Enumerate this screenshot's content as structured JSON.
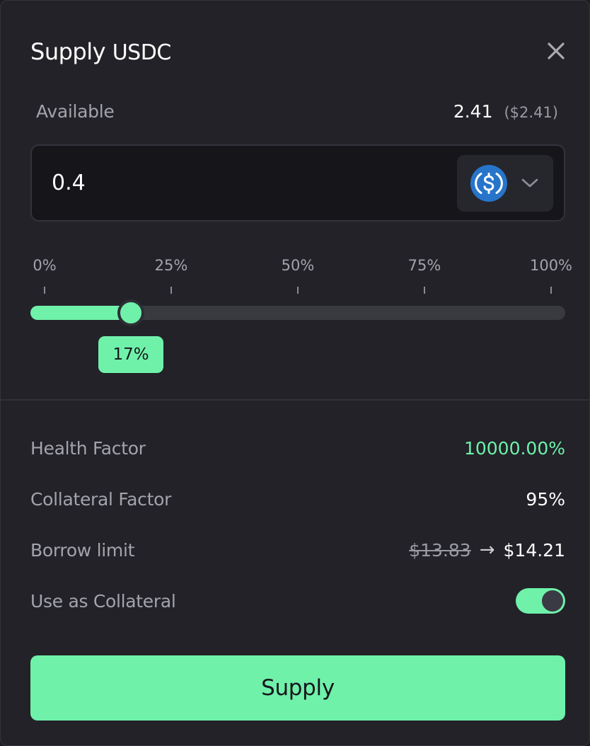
{
  "header": {
    "title": "Supply",
    "symbol": "USDC"
  },
  "available": {
    "label": "Available",
    "amount": "2.41",
    "usd": "($2.41)"
  },
  "amount_input": {
    "value": "0.4",
    "token_icon": "usdc-icon",
    "dropdown_icon": "chevron-down-icon"
  },
  "slider": {
    "ticks": [
      "0%",
      "25%",
      "50%",
      "75%",
      "100%"
    ],
    "value_percent": 17,
    "value_label": "17%"
  },
  "stats": {
    "health_factor": {
      "label": "Health Factor",
      "value": "10000.00%"
    },
    "collateral_factor": {
      "label": "Collateral Factor",
      "value": "95%"
    },
    "borrow_limit": {
      "label": "Borrow limit",
      "old": "$13.83",
      "arrow": "→",
      "new": "$14.21"
    },
    "use_as_collateral": {
      "label": "Use as Collateral",
      "enabled": true
    }
  },
  "actions": {
    "supply_label": "Supply"
  },
  "colors": {
    "accent": "#6ff1aa",
    "background": "#222228",
    "input_background": "#15151a",
    "muted_text": "#a3a3ab",
    "usdc_blue": "#2775ca"
  }
}
